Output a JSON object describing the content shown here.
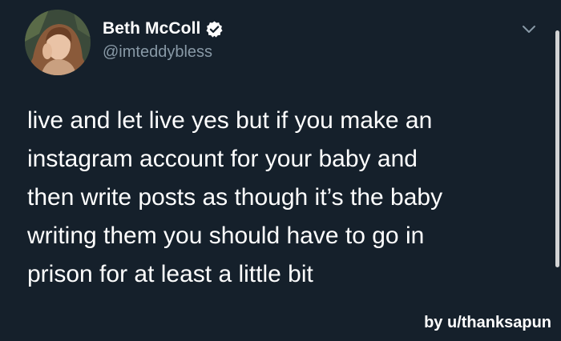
{
  "author": {
    "name": "Beth McColl",
    "handle": "@imteddybless",
    "verified": true
  },
  "tweet": {
    "lines": [
      "live and let live yes but if you make an",
      "instagram account for your baby and",
      "then write posts as though it’s the baby",
      "writing them you should have to go in",
      "prison for at least a little bit"
    ]
  },
  "watermark": "by u/thanksapun",
  "icons": {
    "avatar": "profile-photo",
    "verified": "verified-badge-icon",
    "menu": "chevron-down-icon"
  },
  "colors": {
    "background": "#15202b",
    "text": "#ffffff",
    "secondary_text": "#8899a6",
    "badge": "#ffffff"
  }
}
